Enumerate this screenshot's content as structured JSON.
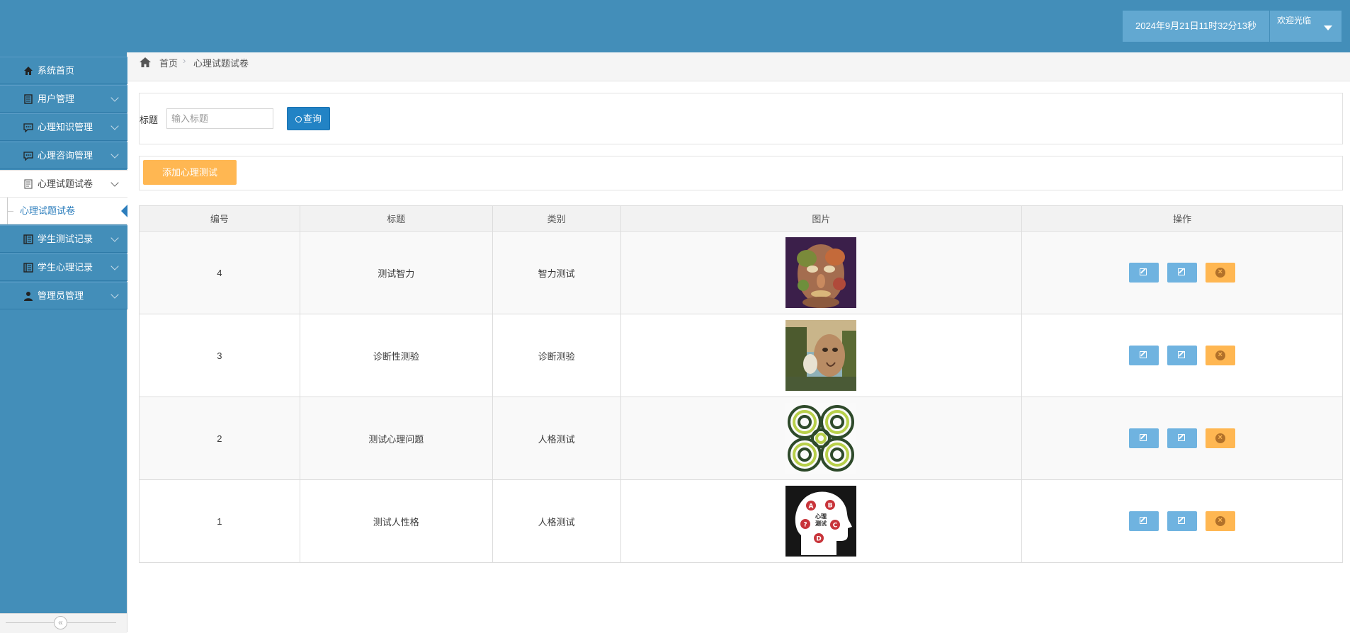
{
  "header": {
    "datetime": "2024年9月21日11时32分13秒",
    "welcome": "欢迎光临"
  },
  "sidebar": {
    "items": [
      {
        "label": "系统首页",
        "icon": "home-icon"
      },
      {
        "label": "用户管理",
        "icon": "list-icon"
      },
      {
        "label": "心理知识管理",
        "icon": "chat-icon"
      },
      {
        "label": "心理咨询管理",
        "icon": "chat-icon"
      },
      {
        "label": "心理试题试卷",
        "icon": "doc-icon"
      },
      {
        "label": "学生测试记录",
        "icon": "book-icon"
      },
      {
        "label": "学生心理记录",
        "icon": "book-icon"
      },
      {
        "label": "管理员管理",
        "icon": "user-icon"
      }
    ],
    "sub_item": "心理试题试卷",
    "collapse": "«"
  },
  "breadcrumb": {
    "home": "首页",
    "separator": "›",
    "current": "心理试题试卷"
  },
  "search": {
    "label": "标题",
    "placeholder": "输入标题",
    "button": "查询"
  },
  "add_button": "添加心理测试",
  "table": {
    "headers": [
      "编号",
      "标题",
      "类别",
      "图片",
      "操作"
    ],
    "rows": [
      {
        "id": "4",
        "title": "测试智力",
        "category": "智力测试",
        "image": "face-portrait"
      },
      {
        "id": "3",
        "title": "诊断性测验",
        "category": "诊断测验",
        "image": "landscape-face"
      },
      {
        "id": "2",
        "title": "测试心理问题",
        "category": "人格测试",
        "image": "spiral-illusion"
      },
      {
        "id": "1",
        "title": "测试人性格",
        "category": "人格测试",
        "image": "head-quiz"
      }
    ],
    "thumb_texts": {
      "quiz_a": "A",
      "quiz_b": "B",
      "quiz_c": "C",
      "quiz_d": "D",
      "quiz_q": "?",
      "quiz_title1": "心理",
      "quiz_title2": "测试"
    }
  },
  "colors": {
    "primary": "#438eb9",
    "header_box": "#62a8d1",
    "search_button": "#2283c5",
    "add_button": "#ffb752",
    "edit_button": "#6fb3e0",
    "delete_button": "#ffb752"
  }
}
